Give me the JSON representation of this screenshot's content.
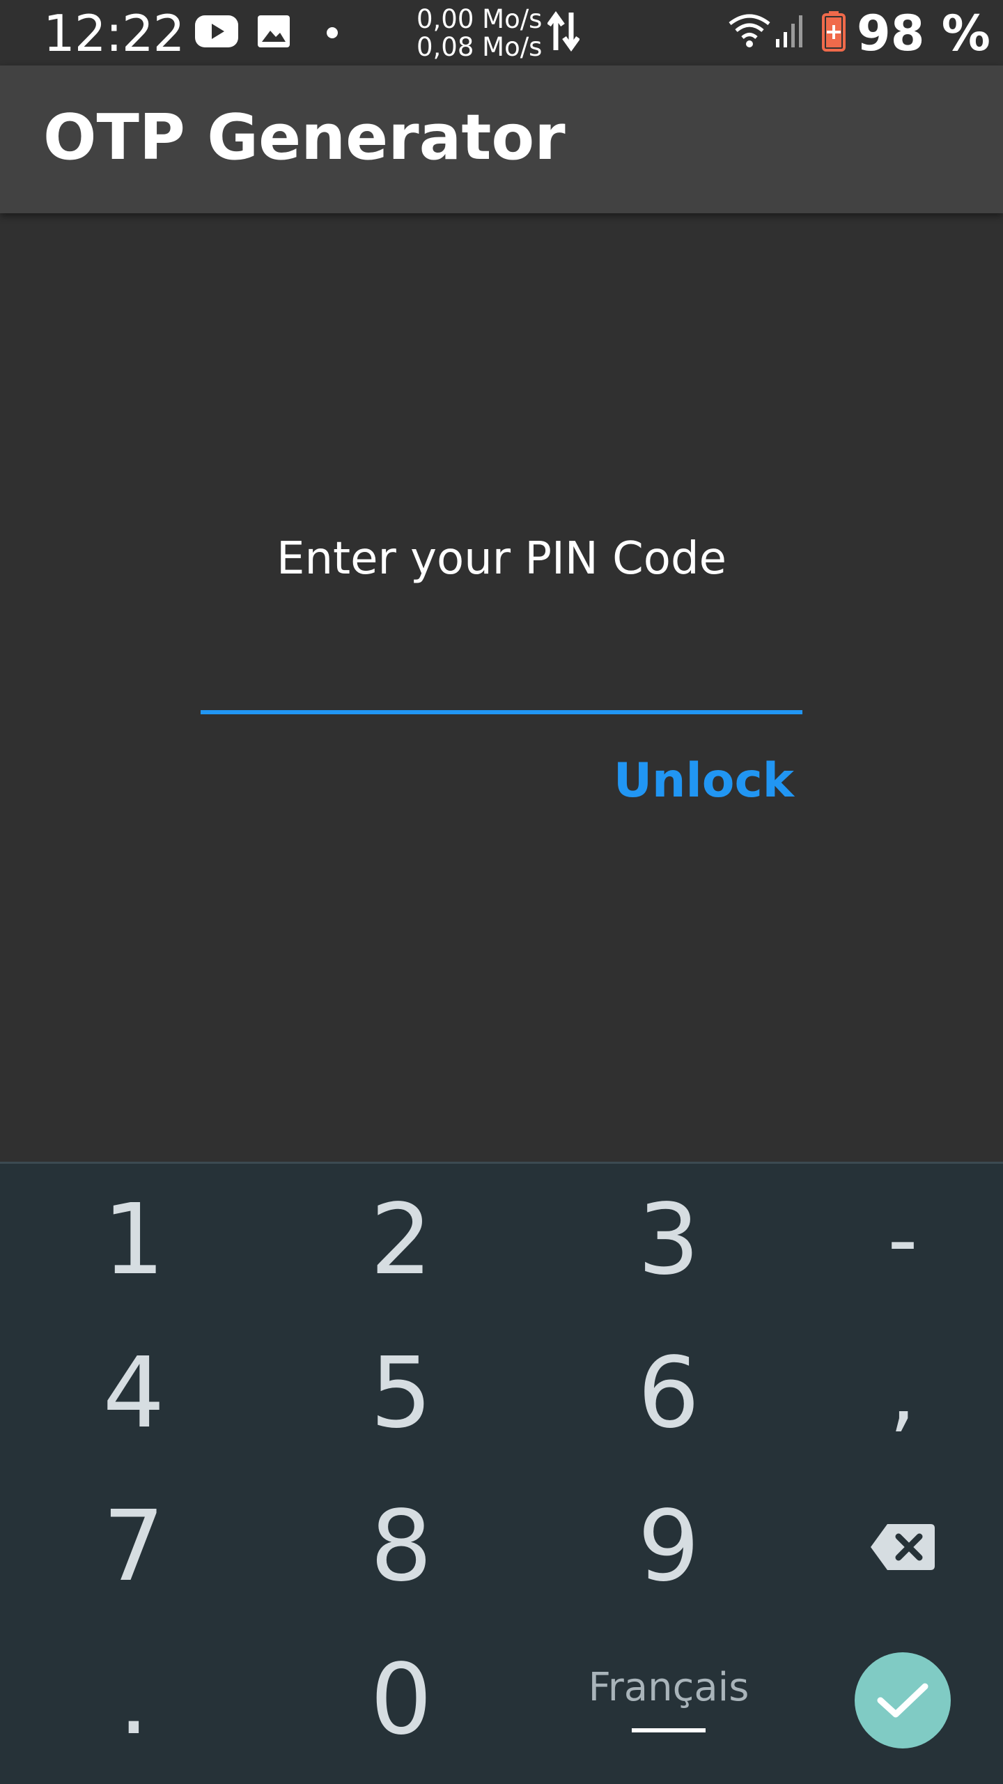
{
  "status_bar": {
    "time": "12:22",
    "net_up": "0,00 Mo/s",
    "net_down": "0,08 Mo/s",
    "battery": "98 %",
    "icons": [
      "youtube-icon",
      "gallery-icon",
      "dot-icon",
      "data-transfer-icon",
      "wifi-icon",
      "signal-icon",
      "battery-charging-icon"
    ]
  },
  "app_bar": {
    "title": "OTP Generator"
  },
  "main": {
    "prompt": "Enter your PIN Code",
    "pin_value": "",
    "unlock_label": "Unlock",
    "accent_color": "#2196f3"
  },
  "keyboard": {
    "rows": [
      [
        "1",
        "2",
        "3",
        "-"
      ],
      [
        "4",
        "5",
        "6",
        ","
      ],
      [
        "7",
        "8",
        "9",
        "backspace"
      ],
      [
        ".",
        "0",
        "Français",
        "enter"
      ]
    ],
    "language_label": "Français",
    "enter_color": "#80cbc4"
  }
}
